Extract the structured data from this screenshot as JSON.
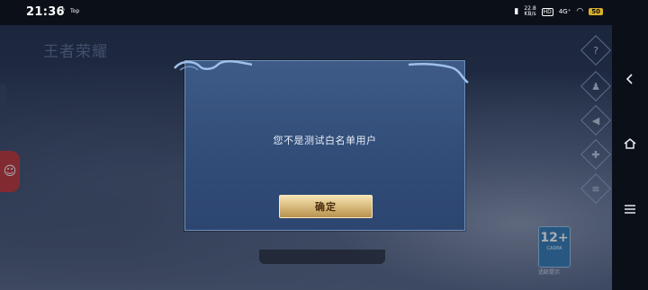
{
  "statusbar": {
    "time": "21:36",
    "notification": "♪",
    "tag": "Top",
    "net_speed_value": "22.8",
    "net_speed_unit": "KB/s",
    "hd": "HD",
    "signal": "4G⁺",
    "battery": "50"
  },
  "background": {
    "logo_text": "王者荣耀",
    "age_rating": "12+",
    "age_sub": "CADPA",
    "age_label": "适龄提示"
  },
  "dialog": {
    "message": "您不是测试白名单用户",
    "confirm_label": "确定"
  },
  "navbar": {
    "back_icon": "back-icon",
    "home_icon": "home-icon",
    "menu_icon": "menu-icon"
  },
  "colors": {
    "dialog_bg": "#3a5580",
    "button_gold": "#dcbf82",
    "battery": "#d9b02a"
  }
}
